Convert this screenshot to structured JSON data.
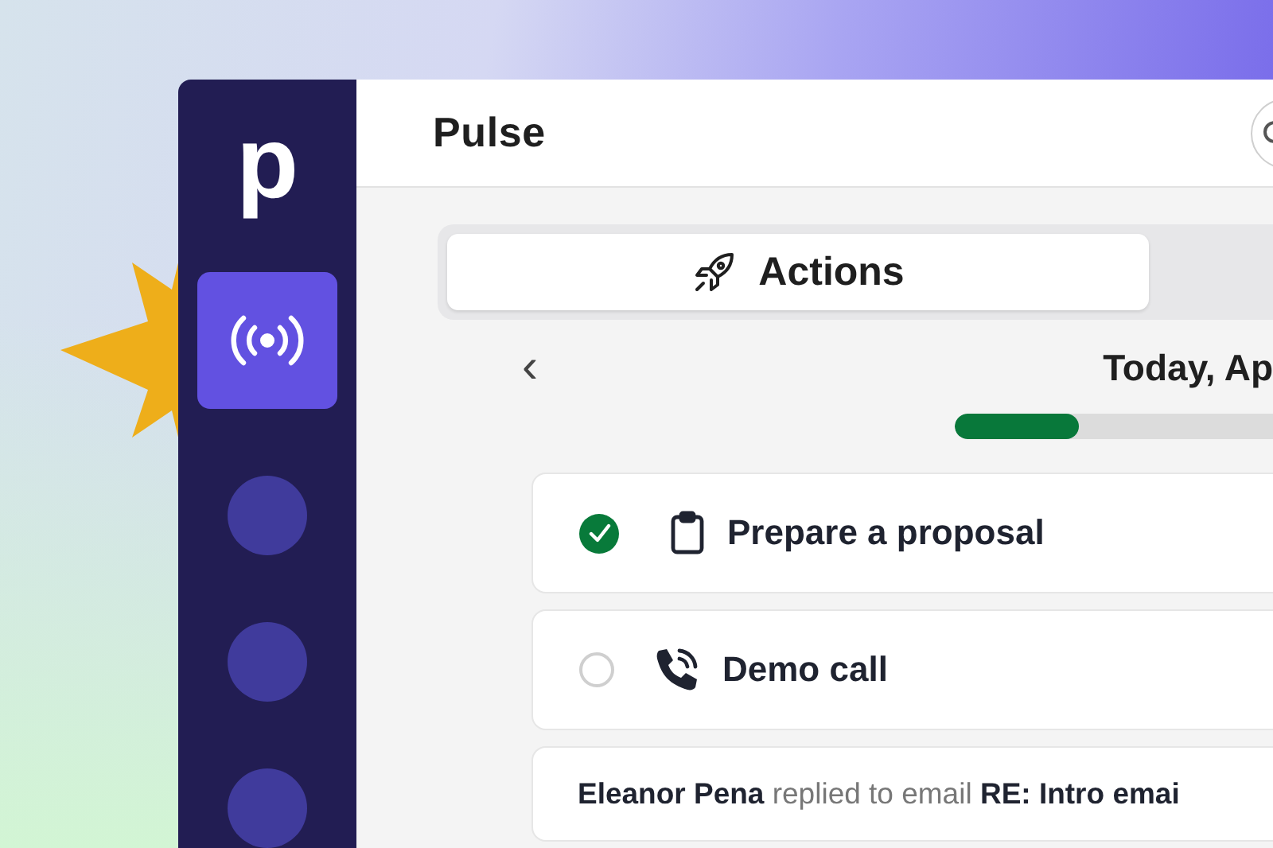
{
  "sidebar": {
    "logo": "p",
    "items": [
      {
        "kind": "pulse",
        "selected": true
      },
      {
        "kind": "blank",
        "selected": false
      },
      {
        "kind": "blank",
        "selected": false
      },
      {
        "kind": "blank",
        "selected": false
      }
    ]
  },
  "header": {
    "title": "Pulse"
  },
  "tabs": [
    {
      "label": "Actions",
      "selected": true
    }
  ],
  "date_nav": {
    "prev": "‹",
    "label": "Today, Ap"
  },
  "progress": {
    "level": 0.39
  },
  "tasks": [
    {
      "kind": "clipboard",
      "title": "Prepare a proposal",
      "done": true
    },
    {
      "kind": "phone",
      "title": "Demo call",
      "done": false
    }
  ],
  "activity": [
    {
      "text": "**Eleanor Pena** replied to email **RE: Intro emai**"
    }
  ]
}
